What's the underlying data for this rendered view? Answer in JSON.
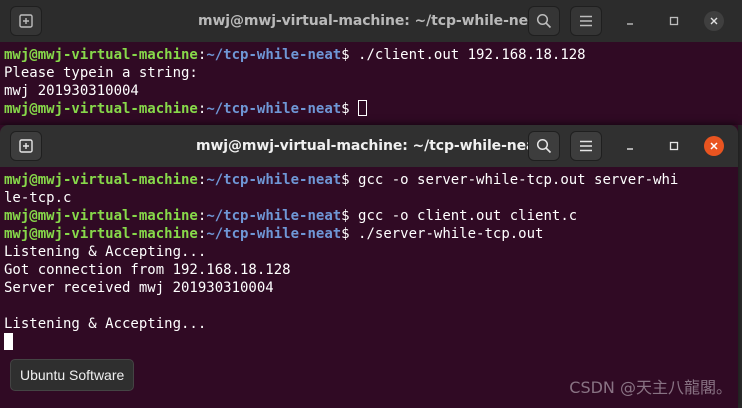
{
  "windows": [
    {
      "title": "mwj@mwj-virtual-machine: ~/tcp-while-neat",
      "lines": [
        [
          [
            "u",
            "mwj@mwj-virtual-machine"
          ],
          [
            "t",
            ":"
          ],
          [
            "p",
            "~/tcp-while-neat"
          ],
          [
            "t",
            "$ ./client.out 192.168.18.128"
          ]
        ],
        [
          [
            "t",
            "Please typein a string:"
          ]
        ],
        [
          [
            "t",
            "mwj 201930310004"
          ]
        ],
        [
          [
            "u",
            "mwj@mwj-virtual-machine"
          ],
          [
            "t",
            ":"
          ],
          [
            "p",
            "~/tcp-while-neat"
          ],
          [
            "t",
            "$ "
          ],
          [
            "cursor-outline",
            ""
          ]
        ]
      ]
    },
    {
      "title": "mwj@mwj-virtual-machine: ~/tcp-while-neat",
      "lines": [
        [
          [
            "u",
            "mwj@mwj-virtual-machine"
          ],
          [
            "t",
            ":"
          ],
          [
            "p",
            "~/tcp-while-neat"
          ],
          [
            "t",
            "$ gcc -o server-while-tcp.out server-whi"
          ]
        ],
        [
          [
            "t",
            "le-tcp.c"
          ]
        ],
        [
          [
            "u",
            "mwj@mwj-virtual-machine"
          ],
          [
            "t",
            ":"
          ],
          [
            "p",
            "~/tcp-while-neat"
          ],
          [
            "t",
            "$ gcc -o client.out client.c"
          ]
        ],
        [
          [
            "u",
            "mwj@mwj-virtual-machine"
          ],
          [
            "t",
            ":"
          ],
          [
            "p",
            "~/tcp-while-neat"
          ],
          [
            "t",
            "$ ./server-while-tcp.out"
          ]
        ],
        [
          [
            "t",
            "Listening & Accepting..."
          ]
        ],
        [
          [
            "t",
            "Got connection from 192.168.18.128"
          ]
        ],
        [
          [
            "t",
            "Server received mwj 201930310004"
          ]
        ],
        [
          [
            "t",
            ""
          ]
        ],
        [
          [
            "t",
            "Listening & Accepting..."
          ]
        ],
        [
          [
            "cursor-solid",
            ""
          ]
        ]
      ]
    }
  ],
  "tooltip": "Ubuntu Software",
  "watermark": "CSDN @天主八龍閣。",
  "colors": {
    "terminal_bg": "#300a24",
    "user_host": "#87d94a",
    "path": "#6f97d6",
    "close_active": "#e95420"
  },
  "icons": [
    "new-tab-icon",
    "search-icon",
    "hamburger-menu-icon",
    "minimize-icon",
    "maximize-icon",
    "close-icon"
  ]
}
